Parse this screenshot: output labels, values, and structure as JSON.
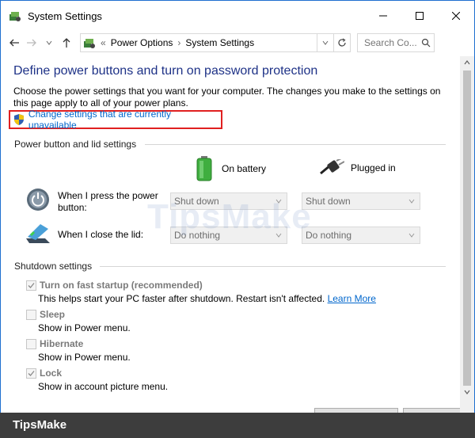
{
  "window": {
    "title": "System Settings",
    "accent": "#1f6fd0"
  },
  "nav": {
    "back_icon": "arrow-left-icon",
    "forward_icon": "arrow-right-icon",
    "up_icon": "arrow-up-icon",
    "breadcrumbs": [
      "Power Options",
      "System Settings"
    ],
    "search_placeholder": "Search Co..."
  },
  "page": {
    "heading": "Define power buttons and turn on password protection",
    "description": "Choose the power settings that you want for your computer. The changes you make to the settings on this page apply to all of your power plans.",
    "change_link": "Change settings that are currently unavailable"
  },
  "power_section": {
    "header": "Power button and lid settings",
    "col_battery": "On battery",
    "col_plugged": "Plugged in",
    "rows": [
      {
        "label": "When I press the power button:",
        "battery": "Shut down",
        "plugged": "Shut down"
      },
      {
        "label": "When I close the lid:",
        "battery": "Do nothing",
        "plugged": "Do nothing"
      }
    ]
  },
  "shutdown_section": {
    "header": "Shutdown settings",
    "options": [
      {
        "label": "Turn on fast startup (recommended)",
        "desc": "This helps start your PC faster after shutdown. Restart isn't affected.",
        "link": "Learn More",
        "checked": true
      },
      {
        "label": "Sleep",
        "desc": "Show in Power menu.",
        "checked": false
      },
      {
        "label": "Hibernate",
        "desc": "Show in Power menu.",
        "checked": false
      },
      {
        "label": "Lock",
        "desc": "Show in account picture menu.",
        "checked": true
      }
    ]
  },
  "watermark": "TipsMake",
  "banner": {
    "text": "TipsMake"
  }
}
